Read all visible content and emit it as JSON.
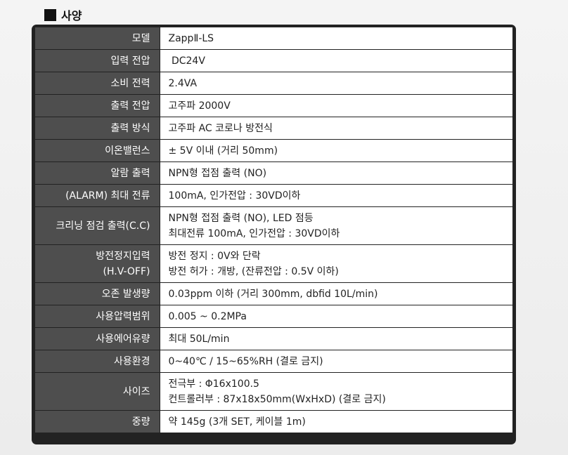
{
  "section_title": "사양",
  "rows": [
    {
      "label": [
        "모델"
      ],
      "value": [
        "ZappⅡ-LS"
      ]
    },
    {
      "label": [
        "입력 전압"
      ],
      "value": [
        " DC24V"
      ]
    },
    {
      "label": [
        "소비 전력"
      ],
      "value": [
        "2.4VA"
      ]
    },
    {
      "label": [
        "출력 전압"
      ],
      "value": [
        "고주파 2000V"
      ]
    },
    {
      "label": [
        "출력 방식"
      ],
      "value": [
        "고주파 AC 코로나 방전식"
      ]
    },
    {
      "label": [
        "이온밸런스"
      ],
      "value": [
        "± 5V 이내 (거리 50mm)"
      ]
    },
    {
      "label": [
        "알람 출력"
      ],
      "value": [
        "NPN형 접점 출력 (NO)"
      ]
    },
    {
      "label": [
        "(ALARM) 최대 전류"
      ],
      "value": [
        "100mA, 인가전압 : 30VD이하"
      ]
    },
    {
      "label": [
        "크리닝 점검 출력(C.C)"
      ],
      "value": [
        "NPN형 접점 출력 (NO), LED 점등",
        "최대전류 100mA, 인가전압 : 30VD이하"
      ]
    },
    {
      "label": [
        "방전정지입력",
        "(H.V-OFF)"
      ],
      "value": [
        "방전 정지 : 0V와 단락",
        "방전 허가 : 개방, (잔류전압 : 0.5V 이하)"
      ]
    },
    {
      "label": [
        "오존 발생량"
      ],
      "value": [
        "0.03ppm 이하 (거리 300mm, dbfid 10L/min)"
      ]
    },
    {
      "label": [
        "사용압력범위"
      ],
      "value": [
        "0.005 ~ 0.2MPa"
      ]
    },
    {
      "label": [
        "사용에어유량"
      ],
      "value": [
        "최대 50L/min"
      ]
    },
    {
      "label": [
        "사용환경"
      ],
      "value": [
        "0~40℃ / 15~65%RH (결로 금지)"
      ]
    },
    {
      "label": [
        "사이즈"
      ],
      "value": [
        "전극부 : Φ16x100.5",
        "컨트롤러부 : 87x18x50mm(WxHxD) (결로 금지)"
      ]
    },
    {
      "label": [
        "중량"
      ],
      "value": [
        "약 145g (3개 SET, 케이블 1m)"
      ]
    }
  ]
}
